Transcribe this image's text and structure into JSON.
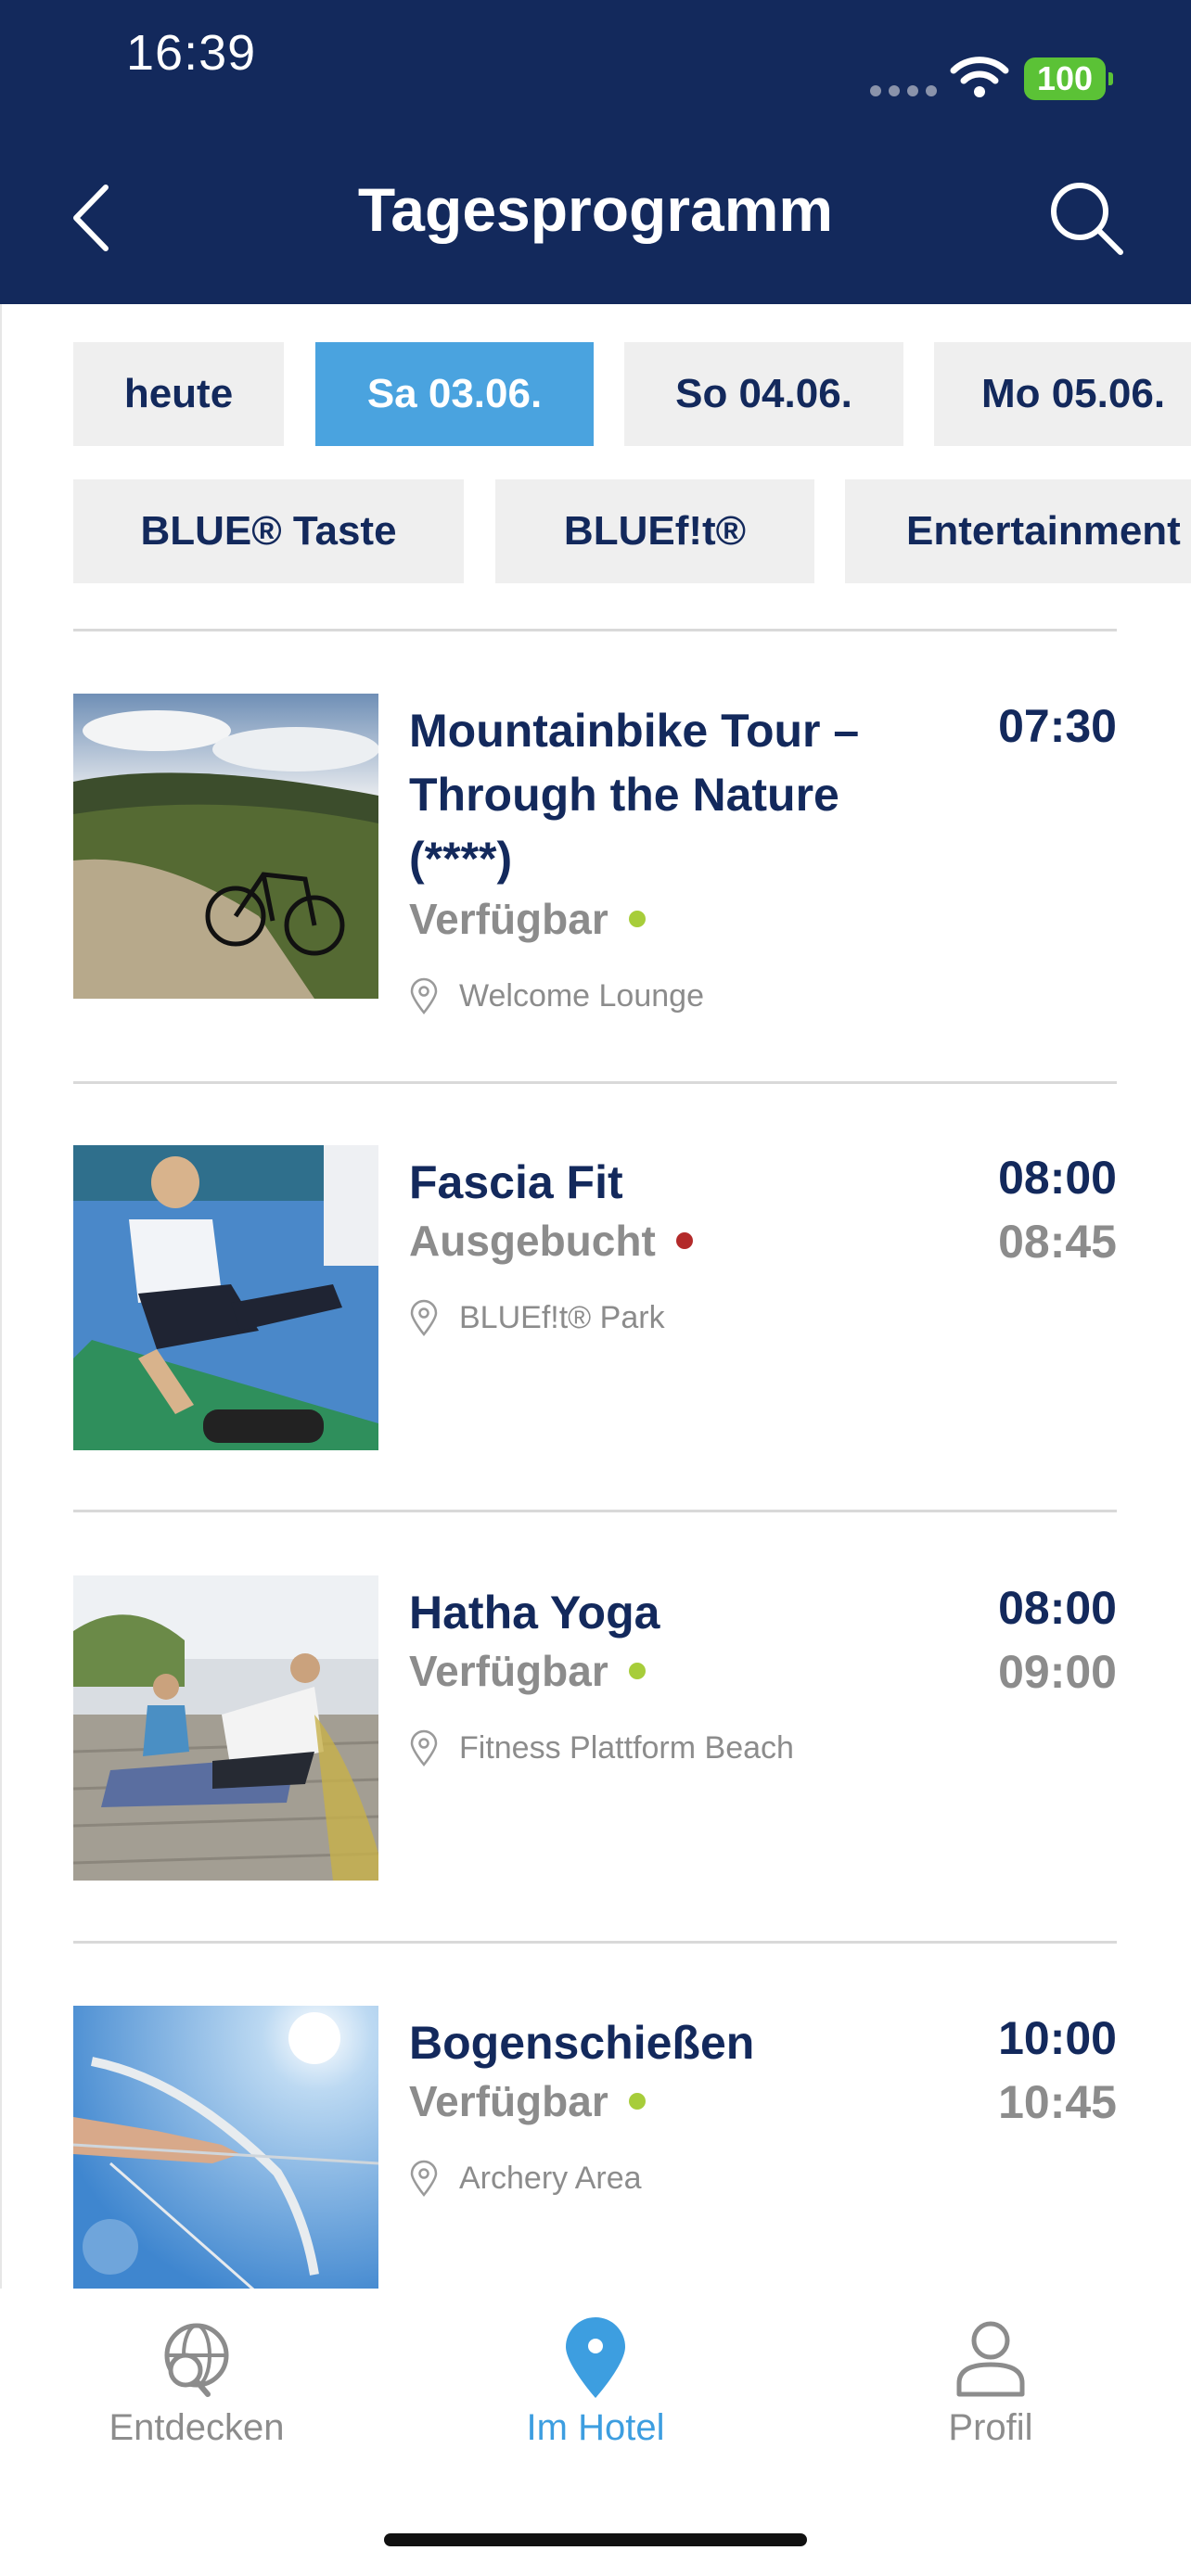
{
  "status_bar": {
    "time": "16:39",
    "battery": "100"
  },
  "header": {
    "title": "Tagesprogramm",
    "back_icon": "chevron-left-icon",
    "search_icon": "search-icon"
  },
  "date_tabs": [
    {
      "label": "heute",
      "selected": false
    },
    {
      "label": "Sa 03.06.",
      "selected": true
    },
    {
      "label": "So 04.06.",
      "selected": false
    },
    {
      "label": "Mo 05.06.",
      "selected": false
    }
  ],
  "category_tabs": [
    {
      "label": "BLUE® Taste"
    },
    {
      "label": "BLUEf!t®"
    },
    {
      "label": "Entertainment"
    }
  ],
  "activities": [
    {
      "title": "Mountainbike Tour – Through the Nature (****)",
      "status": "Verfügbar",
      "status_color": "#a7cd3a",
      "location": "Welcome Lounge",
      "start": "07:30",
      "end": "",
      "image": "mountain-bike-photo"
    },
    {
      "title": "Fascia Fit",
      "status": "Ausgebucht",
      "status_color": "#b32a2a",
      "location": "BLUEf!t® Park",
      "start": "08:00",
      "end": "08:45",
      "image": "fascia-workout-photo"
    },
    {
      "title": "Hatha Yoga",
      "status": "Verfügbar",
      "status_color": "#a7cd3a",
      "location": "Fitness Plattform Beach",
      "start": "08:00",
      "end": "09:00",
      "image": "yoga-photo"
    },
    {
      "title": "Bogenschießen",
      "status": "Verfügbar",
      "status_color": "#a7cd3a",
      "location": "Archery Area",
      "start": "10:00",
      "end": "10:45",
      "image": "archery-photo"
    }
  ],
  "bottom_nav": [
    {
      "label": "Entdecken",
      "icon": "globe-search-icon",
      "active": false
    },
    {
      "label": "Im Hotel",
      "icon": "map-pin-icon",
      "active": true
    },
    {
      "label": "Profil",
      "icon": "user-icon",
      "active": false
    }
  ],
  "colors": {
    "brand_navy": "#13295c",
    "accent_blue": "#4aa3df",
    "available_green": "#a7cd3a",
    "booked_red": "#b32a2a"
  }
}
